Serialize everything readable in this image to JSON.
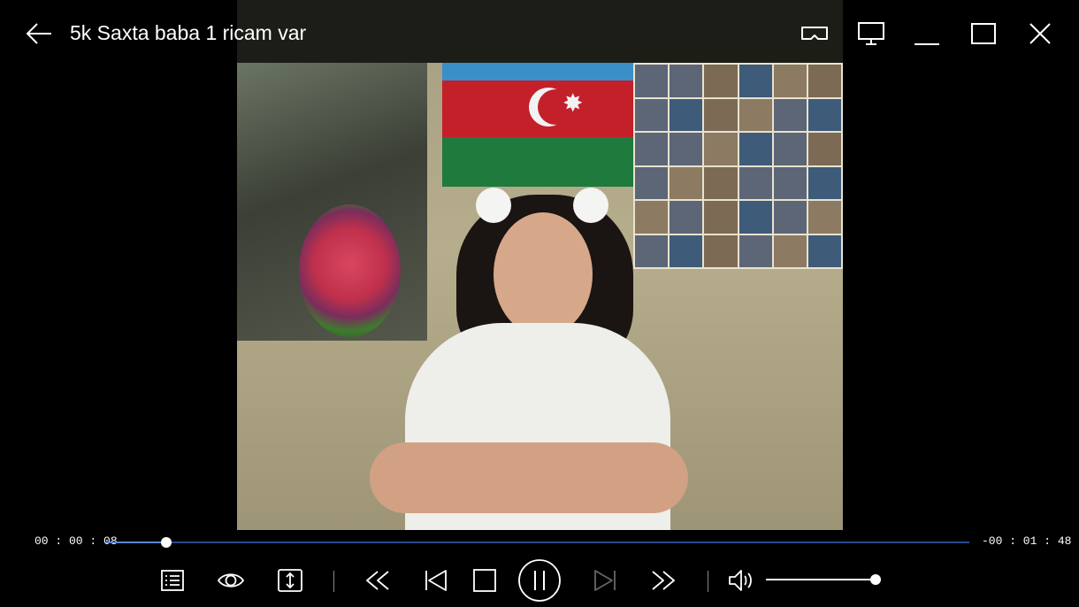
{
  "window": {
    "title": "5k Saxta baba 1 ricam var"
  },
  "playback": {
    "elapsed": "00 : 00 : 08",
    "remaining": "-00 : 01 : 48",
    "progress_fraction": 0.07,
    "state": "playing"
  },
  "volume": {
    "level_fraction": 1.0
  },
  "icons": {
    "back": "back-arrow-icon",
    "vr": "vr-headset-icon",
    "cast": "monitor-icon",
    "minimize": "minimize-icon",
    "maximize": "maximize-icon",
    "close": "close-icon",
    "playlist": "playlist-icon",
    "eye": "eye-icon",
    "resize": "resize-icon",
    "rewind": "rewind-icon",
    "prev": "previous-icon",
    "stop": "stop-icon",
    "pause": "pause-icon",
    "next": "next-icon",
    "fast_forward": "fast-forward-icon",
    "speaker": "speaker-icon"
  },
  "colors": {
    "background": "#000000",
    "seek_track": "#2a4a8e",
    "seek_fill": "#5c86d8",
    "icon": "#ffffff"
  }
}
